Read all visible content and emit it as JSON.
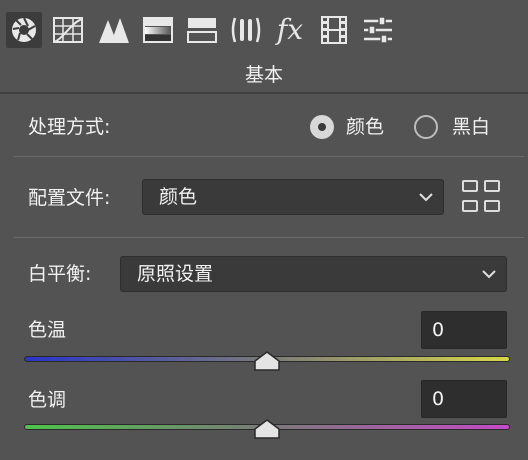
{
  "toolbar": {
    "tabs": [
      {
        "icon": "aperture-icon",
        "active": true
      },
      {
        "icon": "tone-curve-icon",
        "active": false
      },
      {
        "icon": "detail-icon",
        "active": false
      },
      {
        "icon": "hsl-icon",
        "active": false
      },
      {
        "icon": "split-toning-icon",
        "active": false
      },
      {
        "icon": "lens-icon",
        "active": false
      },
      {
        "icon": "fx-icon",
        "label": "fx",
        "active": false
      },
      {
        "icon": "calibration-icon",
        "active": false
      },
      {
        "icon": "presets-icon",
        "active": false
      }
    ]
  },
  "panel": {
    "title": "基本"
  },
  "treatment": {
    "label": "处理方式:",
    "options": [
      {
        "label": "颜色",
        "checked": true
      },
      {
        "label": "黑白",
        "checked": false
      }
    ]
  },
  "profile": {
    "label": "配置文件:",
    "value": "颜色"
  },
  "white_balance": {
    "label": "白平衡:",
    "value": "原照设置"
  },
  "temperature": {
    "label": "色温",
    "value": "0",
    "position": 0.5
  },
  "tint": {
    "label": "色调",
    "value": "0",
    "position": 0.5
  },
  "colors": {
    "temp_track_start": "#2a35c8",
    "temp_track_end": "#d8d84a",
    "tint_track_start": "#4ec44a",
    "tint_track_end": "#c64ac8"
  }
}
